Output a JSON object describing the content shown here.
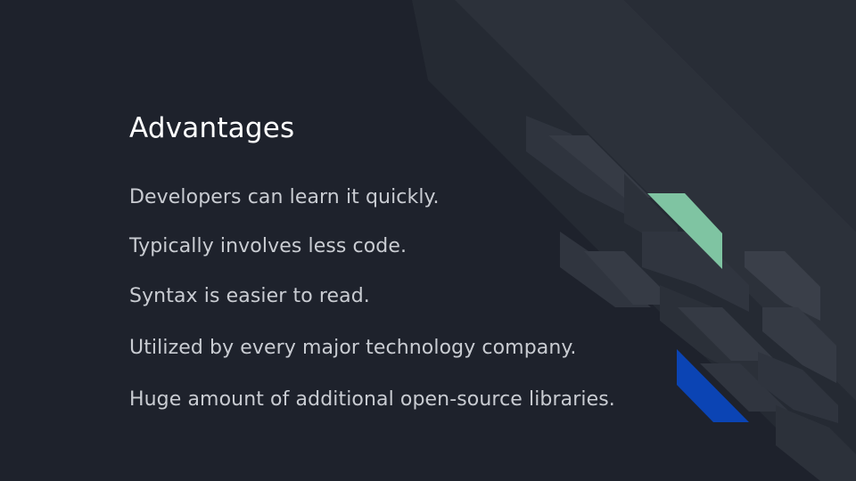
{
  "slide": {
    "title": "Advantages",
    "bullets": [
      "Developers can learn it quickly.",
      "Typically involves less code.",
      "Syntax is easier to read.",
      "Utilized by every major technology company.",
      "Huge amount of additional open-source libraries."
    ]
  },
  "colors": {
    "background": "#1e222c",
    "title": "#ffffff",
    "body_text": "#c9ccd2",
    "accent_green": "#7fc4a2",
    "accent_blue": "#0b44b4",
    "stripe_dark": "#2c313b",
    "stripe_mid": "#363b45"
  }
}
